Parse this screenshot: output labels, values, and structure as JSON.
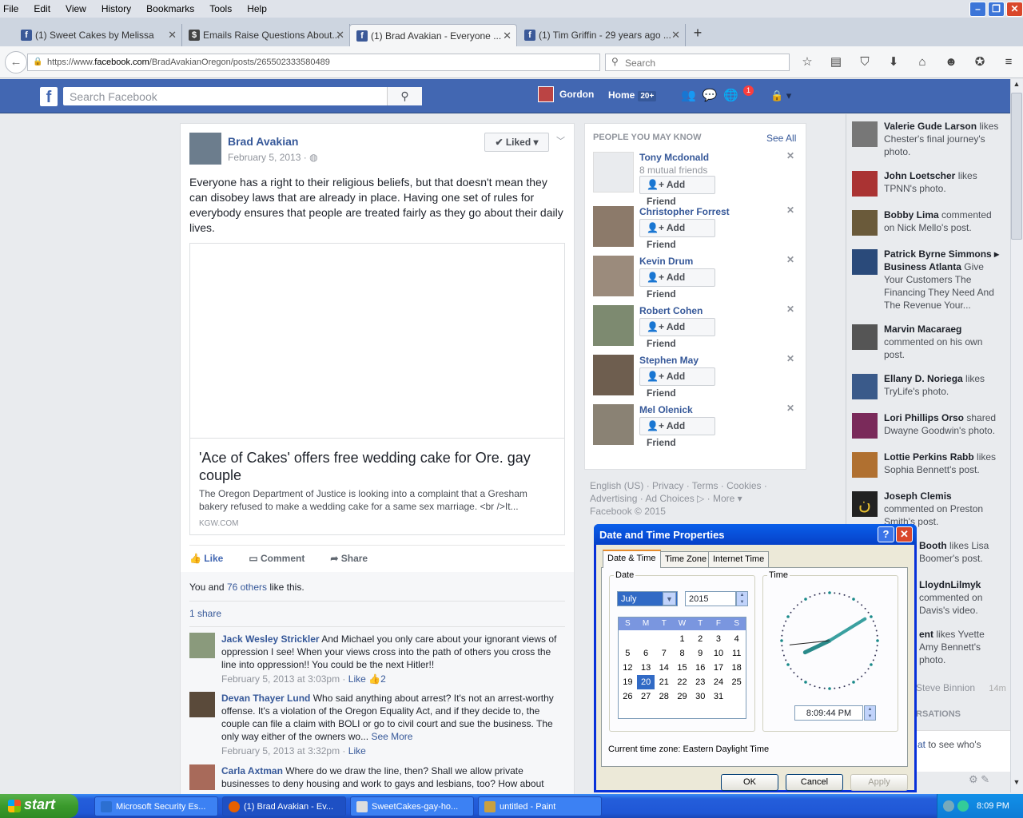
{
  "menubar": {
    "items": [
      "File",
      "Edit",
      "View",
      "History",
      "Bookmarks",
      "Tools",
      "Help"
    ]
  },
  "tabs": [
    {
      "label": "(1) Sweet Cakes by Melissa"
    },
    {
      "label": "Emails Raise Questions About..."
    },
    {
      "label": "(1) Brad Avakian - Everyone ..."
    },
    {
      "label": "(1) Tim Griffin - 29 years ago ..."
    }
  ],
  "nav": {
    "url_prefix": "https://www.",
    "url_host": "facebook.com",
    "url_path": "/BradAvakianOregon/posts/265502333580489",
    "search_placeholder": "Search"
  },
  "fb": {
    "search_placeholder": "Search Facebook",
    "user": "Gordon",
    "home": "Home",
    "home_count": "20+",
    "notif_count": "1"
  },
  "post": {
    "author": "Brad Avakian",
    "date": "February 5, 2013 · ",
    "liked_label": "Liked",
    "text": "Everyone has a right to their religious beliefs, but that doesn't mean they can disobey laws that are already in place. Having one set of rules for everybody ensures that people are treated fairly as they go about their daily lives.",
    "link_title": "'Ace of Cakes' offers free wedding cake for Ore. gay couple",
    "link_desc": "The Oregon Department of Justice is looking into a complaint that a Gresham bakery refused to make a wedding cake for a same sex marriage. <br />It...",
    "link_domain": "KGW.COM",
    "actions": {
      "like": "Like",
      "comment": "Comment",
      "share": "Share"
    },
    "likes_pre": "You and ",
    "likes_link": "76 others",
    "likes_post": " like this.",
    "shares": "1 share"
  },
  "comments": [
    {
      "name": "Jack Wesley Strickler",
      "text": " And Michael you only care about your ignorant views of oppression I see! When your views cross into the path of others you cross the line into oppression!! You could be the next Hitler!!",
      "time": "February 5, 2013 at 3:03pm",
      "like": "Like",
      "count": "2"
    },
    {
      "name": "Devan Thayer Lund",
      "text": " Who said anything about arrest? It's not an arrest-worthy offense. It's a violation of the Oregon Equality Act, and if they decide to, the couple can file a claim with BOLI or go to civil court and sue the business. The only way either of the owners wo... ",
      "more": "See More",
      "time": "February 5, 2013 at 3:32pm",
      "like": "Like"
    },
    {
      "name": "Carla Axtman",
      "text": " Where do we draw the line, then? Shall we allow private businesses to deny housing and work to gays and lesbians, too? How about"
    }
  ],
  "pymk": {
    "header": "PEOPLE YOU MAY KNOW",
    "see_all": "See All",
    "add_label": "Add Friend",
    "people": [
      {
        "name": "Tony Mcdonald",
        "mutual": "8 mutual friends"
      },
      {
        "name": "Christopher Forrest"
      },
      {
        "name": "Kevin Drum"
      },
      {
        "name": "Robert Cohen"
      },
      {
        "name": "Stephen May"
      },
      {
        "name": "Mel Olenick"
      }
    ]
  },
  "footer": {
    "line1": "English (US) · Privacy · Terms · Cookies ·",
    "line2": "Advertising · Ad Choices ▷ · More ▾",
    "line3": "Facebook © 2015"
  },
  "ticker": [
    {
      "name": "Valerie Gude Larson",
      "text": " likes Chester's final journey's photo."
    },
    {
      "name": "John Loetscher",
      "text": " likes TPNN's photo."
    },
    {
      "name": "Bobby Lima",
      "text": " commented on Nick Mello's post."
    },
    {
      "name": "Patrick Byrne Simmons",
      "sub": " ▸ Business Atlanta",
      "text": " Give Your Customers The Financing They Need And The Revenue Your..."
    },
    {
      "name": "Marvin Macaraeg",
      "text": " commented on his own post."
    },
    {
      "name": "Ellany D. Noriega",
      "text": " likes TryLife's photo."
    },
    {
      "name": "Lori Phillips Orso",
      "text": " shared Dwayne Goodwin's photo."
    },
    {
      "name": "Lottie Perkins Rabb",
      "text": " likes Sophia Bennett's post."
    },
    {
      "name": "Joseph Clemis",
      "text": " commented on Preston Smith's post."
    }
  ],
  "ticker_hidden": [
    {
      "name": "Booth",
      "text": " likes Lisa Boomer's post."
    },
    {
      "name": "LloydnLilmyk",
      "text": " commented on Davis's video."
    },
    {
      "name": "ent",
      "text": " likes Yvette Amy Bennett's photo."
    }
  ],
  "chat": {
    "friend": "Steve Binnion",
    "time": "14m",
    "section": "RSATIONS",
    "hint_pre": "at",
    "hint_post": " to see who's"
  },
  "dialog": {
    "title": "Date and Time Properties",
    "tabs": [
      "Date & Time",
      "Time Zone",
      "Internet Time"
    ],
    "date_label": "Date",
    "time_label": "Time",
    "month": "July",
    "year": "2015",
    "weekdays": [
      "S",
      "M",
      "T",
      "W",
      "T",
      "F",
      "S"
    ],
    "weeks": [
      [
        "",
        "",
        "",
        "1",
        "2",
        "3",
        "4"
      ],
      [
        "5",
        "6",
        "7",
        "8",
        "9",
        "10",
        "11"
      ],
      [
        "12",
        "13",
        "14",
        "15",
        "16",
        "17",
        "18"
      ],
      [
        "19",
        "20",
        "21",
        "22",
        "23",
        "24",
        "25"
      ],
      [
        "26",
        "27",
        "28",
        "29",
        "30",
        "31",
        ""
      ]
    ],
    "selected_day": "20",
    "time": "8:09:44 PM",
    "clock": {
      "hour": 20,
      "minute": 9,
      "second": 44
    },
    "tz_label": "Current time zone:  Eastern Daylight Time",
    "ok": "OK",
    "cancel": "Cancel",
    "apply": "Apply"
  },
  "taskbar": {
    "start": "start",
    "items": [
      "Microsoft Security Es...",
      "(1) Brad Avakian - Ev...",
      "SweetCakes-gay-ho...",
      "untitled - Paint"
    ],
    "clock": "8:09 PM"
  }
}
